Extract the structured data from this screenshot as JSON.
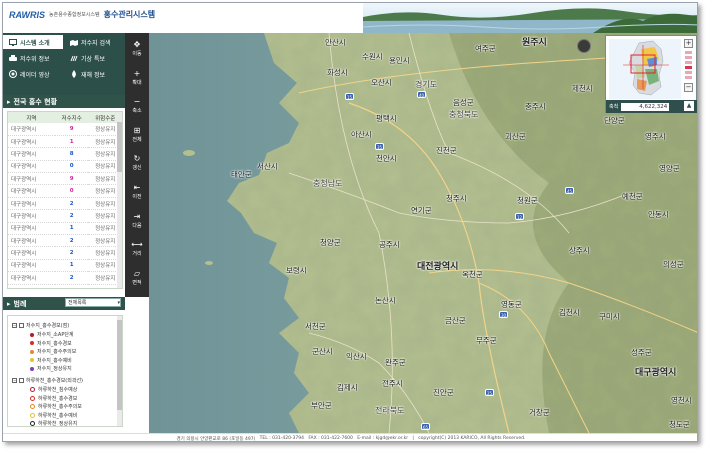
{
  "header": {
    "logo_mark": "RAWRIS",
    "logo_sub": "농촌용수종합정보시스템",
    "system_title": "홍수관리시스템"
  },
  "menu": {
    "items": [
      {
        "label": "시스템 소개",
        "icon": "monitor-icon",
        "active": true
      },
      {
        "label": "저수지 검색",
        "icon": "search-map-icon",
        "active": false
      },
      {
        "label": "저수위 정보",
        "icon": "water-level-icon",
        "active": false
      },
      {
        "label": "기상 특보",
        "icon": "weather-alert-icon",
        "active": false
      },
      {
        "label": "레이더 영상",
        "icon": "radar-icon",
        "active": false
      },
      {
        "label": "재해 정보",
        "icon": "disaster-icon",
        "active": false
      }
    ]
  },
  "status_panel": {
    "title": "전국 홍수 현황",
    "columns": [
      "지역",
      "저수지수",
      "위험수준"
    ],
    "rows": [
      {
        "region": "대구광역시",
        "count": "9",
        "level": "정상유지",
        "color": "pink"
      },
      {
        "region": "대구광역시",
        "count": "1",
        "level": "정상유지",
        "color": "pink"
      },
      {
        "region": "대구광역시",
        "count": "8",
        "level": "정상유지",
        "color": "blue"
      },
      {
        "region": "대구광역시",
        "count": "0",
        "level": "정상유지",
        "color": "blue"
      },
      {
        "region": "대구광역시",
        "count": "9",
        "level": "정상유지",
        "color": "pink"
      },
      {
        "region": "대구광역시",
        "count": "0",
        "level": "정상유지",
        "color": "pink"
      },
      {
        "region": "대구광역시",
        "count": "2",
        "level": "정상유지",
        "color": "blue"
      },
      {
        "region": "대구광역시",
        "count": "2",
        "level": "정상유지",
        "color": "blue"
      },
      {
        "region": "대구광역시",
        "count": "1",
        "level": "정상유지",
        "color": "blue"
      },
      {
        "region": "대구광역시",
        "count": "2",
        "level": "정상유지",
        "color": "blue"
      },
      {
        "region": "대구광역시",
        "count": "2",
        "level": "정상유지",
        "color": "blue"
      },
      {
        "region": "대구광역시",
        "count": "1",
        "level": "정상유지",
        "color": "blue"
      },
      {
        "region": "대구광역시",
        "count": "2",
        "level": "정상유지",
        "color": "blue"
      }
    ]
  },
  "legend_panel": {
    "title": "범례",
    "select_value": "전체목록",
    "groups": [
      {
        "label": "저수지_홍수경보(점)",
        "items": [
          {
            "label": "저수지_소AP단계",
            "color": "#b01c2e",
            "style": "dot"
          },
          {
            "label": "저수지_홍수경보",
            "color": "#d62b2b",
            "style": "dot"
          },
          {
            "label": "저수지_홍수주의보",
            "color": "#e3892b",
            "style": "dot"
          },
          {
            "label": "저수지_홍수예비",
            "color": "#e0c52d",
            "style": "dot"
          },
          {
            "label": "저수지_정상유지",
            "color": "#7b3fbf",
            "style": "dot"
          }
        ]
      },
      {
        "label": "하류하천_홍수경보(외곽선)",
        "items": [
          {
            "label": "하류하천_침수예상",
            "color": "#b01c2e",
            "style": "ring"
          },
          {
            "label": "하류하천_홍수경보",
            "color": "#d62b2b",
            "style": "ring"
          },
          {
            "label": "하류하천_홍수주의보",
            "color": "#e3892b",
            "style": "ring"
          },
          {
            "label": "하류하천_홍수예비",
            "color": "#e0c52d",
            "style": "ring"
          },
          {
            "label": "하류하천_정상유지",
            "color": "#222222",
            "style": "ring"
          }
        ]
      }
    ]
  },
  "toolbar": {
    "tools": [
      {
        "label": "이동",
        "glyph": "✥",
        "icon": "pan-icon"
      },
      {
        "label": "확대",
        "glyph": "+",
        "icon": "zoom-in-icon"
      },
      {
        "label": "축소",
        "glyph": "−",
        "icon": "zoom-out-icon"
      },
      {
        "label": "전체",
        "glyph": "⊞",
        "icon": "full-extent-icon"
      },
      {
        "label": "갱신",
        "glyph": "↻",
        "icon": "refresh-icon"
      },
      {
        "label": "이전",
        "glyph": "⇤",
        "icon": "previous-icon"
      },
      {
        "label": "다음",
        "glyph": "⇥",
        "icon": "next-icon"
      },
      {
        "label": "거리",
        "glyph": "⟷",
        "icon": "distance-icon"
      },
      {
        "label": "면적",
        "glyph": "▱",
        "icon": "area-icon"
      }
    ]
  },
  "map": {
    "places": [
      {
        "name": "안산시",
        "cls": ""
      },
      {
        "name": "수원시",
        "cls": ""
      },
      {
        "name": "여주군",
        "cls": ""
      },
      {
        "name": "원주시",
        "cls": "big"
      },
      {
        "name": "화성시",
        "cls": ""
      },
      {
        "name": "용인시",
        "cls": ""
      },
      {
        "name": "오산시",
        "cls": ""
      },
      {
        "name": "경기도",
        "cls": "prov"
      },
      {
        "name": "제천시",
        "cls": ""
      },
      {
        "name": "평택시",
        "cls": ""
      },
      {
        "name": "음성군",
        "cls": ""
      },
      {
        "name": "충주시",
        "cls": ""
      },
      {
        "name": "충청북도",
        "cls": "prov"
      },
      {
        "name": "단양군",
        "cls": ""
      },
      {
        "name": "아산시",
        "cls": ""
      },
      {
        "name": "천안시",
        "cls": ""
      },
      {
        "name": "괴산군",
        "cls": ""
      },
      {
        "name": "진천군",
        "cls": ""
      },
      {
        "name": "청주시",
        "cls": ""
      },
      {
        "name": "서산시",
        "cls": ""
      },
      {
        "name": "태안군",
        "cls": ""
      },
      {
        "name": "충청남도",
        "cls": "prov"
      },
      {
        "name": "연기군",
        "cls": ""
      },
      {
        "name": "청원군",
        "cls": ""
      },
      {
        "name": "영주시",
        "cls": ""
      },
      {
        "name": "예천군",
        "cls": ""
      },
      {
        "name": "안동시",
        "cls": ""
      },
      {
        "name": "청양군",
        "cls": ""
      },
      {
        "name": "공주시",
        "cls": ""
      },
      {
        "name": "대전광역시",
        "cls": "big"
      },
      {
        "name": "상주시",
        "cls": ""
      },
      {
        "name": "보령시",
        "cls": ""
      },
      {
        "name": "옥천군",
        "cls": ""
      },
      {
        "name": "의성군",
        "cls": ""
      },
      {
        "name": "논산시",
        "cls": ""
      },
      {
        "name": "영동군",
        "cls": ""
      },
      {
        "name": "김천시",
        "cls": ""
      },
      {
        "name": "금산군",
        "cls": ""
      },
      {
        "name": "구미시",
        "cls": ""
      },
      {
        "name": "서천군",
        "cls": ""
      },
      {
        "name": "무주군",
        "cls": ""
      },
      {
        "name": "군산시",
        "cls": ""
      },
      {
        "name": "익산시",
        "cls": ""
      },
      {
        "name": "성주군",
        "cls": ""
      },
      {
        "name": "완주군",
        "cls": ""
      },
      {
        "name": "대구광역시",
        "cls": "big"
      },
      {
        "name": "김제시",
        "cls": ""
      },
      {
        "name": "전주시",
        "cls": ""
      },
      {
        "name": "진안군",
        "cls": ""
      },
      {
        "name": "부안군",
        "cls": ""
      },
      {
        "name": "전라북도",
        "cls": "prov"
      },
      {
        "name": "거창군",
        "cls": ""
      },
      {
        "name": "청도군",
        "cls": ""
      },
      {
        "name": "영천시",
        "cls": ""
      },
      {
        "name": "영양군",
        "cls": ""
      }
    ],
    "routes": [
      "15",
      "40",
      "35",
      "45",
      "12",
      "30",
      "65",
      "25"
    ]
  },
  "overview": {
    "scale_label": "축척",
    "scale_value": "4,622,324",
    "collapse_glyph": "▲",
    "zoom_in": "+",
    "zoom_out": "−"
  },
  "footer": {
    "address": "경기 의왕시 안양판교로 86 (포일동 497)",
    "tel": "TEL : 031-420-3794",
    "fax": "FAX : 031-422-7600",
    "email": "E-mail : kjgd@ekr.or.kr",
    "copyright": "copyright(C) 2013 KARICO, All Rights Reserved."
  },
  "colors": {
    "menu_bg": "#2d4f4a",
    "toolbar_bg": "#2e2e2e",
    "sea": "#7fa0a4",
    "land": "#b6c28f",
    "accent_blue": "#1d56c8",
    "accent_pink": "#d12a9a"
  }
}
